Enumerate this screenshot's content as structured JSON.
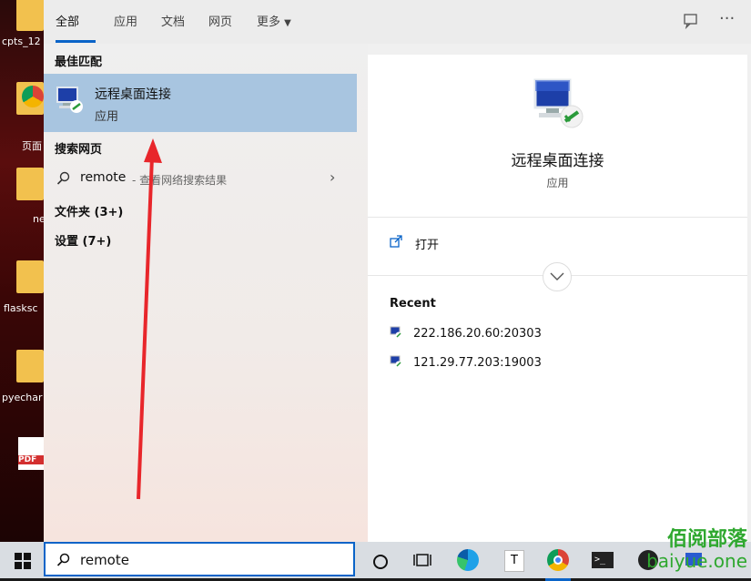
{
  "tabs": [
    "全部",
    "应用",
    "文档",
    "网页",
    "更多"
  ],
  "desktop_labels": [
    "cpts_12",
    "页面",
    "ne",
    "flasksc",
    "pyechar"
  ],
  "sections": {
    "best_match": "最佳匹配",
    "search_web": "搜索网页",
    "folders": "文件夹 (3+)",
    "settings": "设置 (7+)"
  },
  "best_match_item": {
    "title": "远程桌面连接",
    "subtitle": "应用"
  },
  "web_search": {
    "query": "remote",
    "suffix": " - 查看网络搜索结果"
  },
  "detail": {
    "title": "远程桌面连接",
    "subtitle": "应用",
    "open_label": "打开",
    "recent_header": "Recent",
    "recent_items": [
      "222.186.20.60:20303",
      "121.29.77.203:19003"
    ]
  },
  "taskbar": {
    "search_value": "remote"
  },
  "watermark": {
    "cn": "佰阅部落",
    "url": "baiyue.one"
  },
  "colors": {
    "accent": "#0a64c8",
    "highlight": "#a8c5e0",
    "arrow": "#e8262b"
  }
}
